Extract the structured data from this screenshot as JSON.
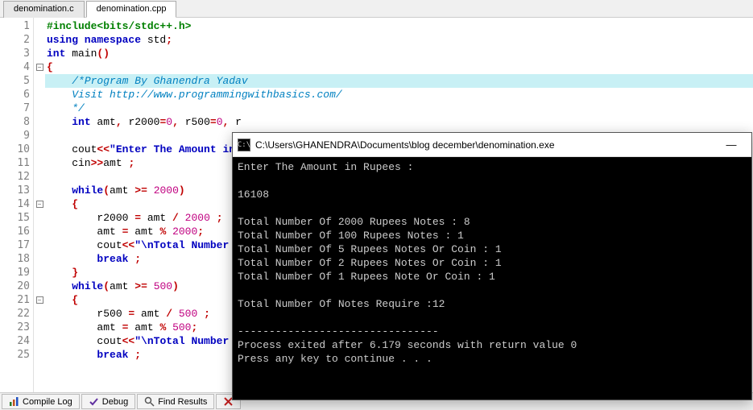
{
  "tabs": {
    "items": [
      "denomination.c",
      "denomination.cpp"
    ],
    "active_index": 1
  },
  "code": {
    "lines": [
      {
        "n": 1,
        "fold": "",
        "hl": false,
        "tokens": [
          [
            "pp",
            "#include<bits/stdc++.h>"
          ]
        ]
      },
      {
        "n": 2,
        "fold": "",
        "hl": false,
        "tokens": [
          [
            "kw",
            "using namespace"
          ],
          [
            "plain",
            " std"
          ],
          [
            "op",
            ";"
          ]
        ]
      },
      {
        "n": 3,
        "fold": "",
        "hl": false,
        "tokens": [
          [
            "kw",
            "int"
          ],
          [
            "plain",
            " main"
          ],
          [
            "br",
            "()"
          ]
        ]
      },
      {
        "n": 4,
        "fold": "-",
        "hl": false,
        "tokens": [
          [
            "br",
            "{"
          ]
        ]
      },
      {
        "n": 5,
        "fold": "",
        "hl": true,
        "tokens": [
          [
            "plain",
            "    "
          ],
          [
            "cmt",
            "/*Program By Ghanendra Yadav"
          ]
        ]
      },
      {
        "n": 6,
        "fold": "",
        "hl": false,
        "tokens": [
          [
            "plain",
            "    "
          ],
          [
            "cmt",
            "Visit http://www.programmingwithbasics.com/"
          ]
        ]
      },
      {
        "n": 7,
        "fold": "",
        "hl": false,
        "tokens": [
          [
            "plain",
            "    "
          ],
          [
            "cmt",
            "*/"
          ]
        ]
      },
      {
        "n": 8,
        "fold": "",
        "hl": false,
        "tokens": [
          [
            "plain",
            "    "
          ],
          [
            "kw",
            "int"
          ],
          [
            "plain",
            " amt"
          ],
          [
            "op",
            ","
          ],
          [
            "plain",
            " r2000"
          ],
          [
            "op",
            "="
          ],
          [
            "num",
            "0"
          ],
          [
            "op",
            ","
          ],
          [
            "plain",
            " r500"
          ],
          [
            "op",
            "="
          ],
          [
            "num",
            "0"
          ],
          [
            "op",
            ","
          ],
          [
            "plain",
            " r"
          ]
        ]
      },
      {
        "n": 9,
        "fold": "",
        "hl": false,
        "tokens": []
      },
      {
        "n": 10,
        "fold": "",
        "hl": false,
        "tokens": [
          [
            "plain",
            "    cout"
          ],
          [
            "op",
            "<<"
          ],
          [
            "str",
            "\"Enter The Amount in "
          ]
        ]
      },
      {
        "n": 11,
        "fold": "",
        "hl": false,
        "tokens": [
          [
            "plain",
            "    cin"
          ],
          [
            "op",
            ">>"
          ],
          [
            "plain",
            "amt "
          ],
          [
            "op",
            ";"
          ]
        ]
      },
      {
        "n": 12,
        "fold": "",
        "hl": false,
        "tokens": []
      },
      {
        "n": 13,
        "fold": "",
        "hl": false,
        "tokens": [
          [
            "plain",
            "    "
          ],
          [
            "kw",
            "while"
          ],
          [
            "br",
            "("
          ],
          [
            "plain",
            "amt "
          ],
          [
            "op",
            ">="
          ],
          [
            "plain",
            " "
          ],
          [
            "num",
            "2000"
          ],
          [
            "br",
            ")"
          ]
        ]
      },
      {
        "n": 14,
        "fold": "-",
        "hl": false,
        "tokens": [
          [
            "plain",
            "    "
          ],
          [
            "br",
            "{"
          ]
        ]
      },
      {
        "n": 15,
        "fold": "",
        "hl": false,
        "tokens": [
          [
            "plain",
            "        r2000 "
          ],
          [
            "op",
            "="
          ],
          [
            "plain",
            " amt "
          ],
          [
            "op",
            "/"
          ],
          [
            "plain",
            " "
          ],
          [
            "num",
            "2000"
          ],
          [
            "plain",
            " "
          ],
          [
            "op",
            ";"
          ]
        ]
      },
      {
        "n": 16,
        "fold": "",
        "hl": false,
        "tokens": [
          [
            "plain",
            "        amt "
          ],
          [
            "op",
            "="
          ],
          [
            "plain",
            " amt "
          ],
          [
            "op",
            "%"
          ],
          [
            "plain",
            " "
          ],
          [
            "num",
            "2000"
          ],
          [
            "op",
            ";"
          ]
        ]
      },
      {
        "n": 17,
        "fold": "",
        "hl": false,
        "tokens": [
          [
            "plain",
            "        cout"
          ],
          [
            "op",
            "<<"
          ],
          [
            "str",
            "\"\\nTotal Number O"
          ]
        ]
      },
      {
        "n": 18,
        "fold": "",
        "hl": false,
        "tokens": [
          [
            "plain",
            "        "
          ],
          [
            "kw",
            "break"
          ],
          [
            "plain",
            " "
          ],
          [
            "op",
            ";"
          ]
        ]
      },
      {
        "n": 19,
        "fold": "",
        "hl": false,
        "tokens": [
          [
            "plain",
            "    "
          ],
          [
            "br",
            "}"
          ]
        ]
      },
      {
        "n": 20,
        "fold": "",
        "hl": false,
        "tokens": [
          [
            "plain",
            "    "
          ],
          [
            "kw",
            "while"
          ],
          [
            "br",
            "("
          ],
          [
            "plain",
            "amt "
          ],
          [
            "op",
            ">="
          ],
          [
            "plain",
            " "
          ],
          [
            "num",
            "500"
          ],
          [
            "br",
            ")"
          ]
        ]
      },
      {
        "n": 21,
        "fold": "-",
        "hl": false,
        "tokens": [
          [
            "plain",
            "    "
          ],
          [
            "br",
            "{"
          ]
        ]
      },
      {
        "n": 22,
        "fold": "",
        "hl": false,
        "tokens": [
          [
            "plain",
            "        r500 "
          ],
          [
            "op",
            "="
          ],
          [
            "plain",
            " amt "
          ],
          [
            "op",
            "/"
          ],
          [
            "plain",
            " "
          ],
          [
            "num",
            "500"
          ],
          [
            "plain",
            " "
          ],
          [
            "op",
            ";"
          ]
        ]
      },
      {
        "n": 23,
        "fold": "",
        "hl": false,
        "tokens": [
          [
            "plain",
            "        amt "
          ],
          [
            "op",
            "="
          ],
          [
            "plain",
            " amt "
          ],
          [
            "op",
            "%"
          ],
          [
            "plain",
            " "
          ],
          [
            "num",
            "500"
          ],
          [
            "op",
            ";"
          ]
        ]
      },
      {
        "n": 24,
        "fold": "",
        "hl": false,
        "tokens": [
          [
            "plain",
            "        cout"
          ],
          [
            "op",
            "<<"
          ],
          [
            "str",
            "\"\\nTotal Number O"
          ]
        ]
      },
      {
        "n": 25,
        "fold": "",
        "hl": false,
        "tokens": [
          [
            "plain",
            "        "
          ],
          [
            "kw",
            "break"
          ],
          [
            "plain",
            " "
          ],
          [
            "op",
            ";"
          ]
        ]
      }
    ]
  },
  "console": {
    "title": "C:\\Users\\GHANENDRA\\Documents\\blog december\\denomination.exe",
    "icon_glyph": "C:\\",
    "minimize": "—",
    "lines": [
      "Enter The Amount in Rupees :",
      "",
      "16108",
      "",
      "Total Number Of 2000 Rupees Notes : 8",
      "Total Number Of 100 Rupees Notes : 1",
      "Total Number Of 5 Rupees Notes Or Coin : 1",
      "Total Number Of 2 Rupees Notes Or Coin : 1",
      "Total Number Of 1 Rupees Note Or Coin : 1",
      "",
      "Total Number Of Notes Require :12",
      "",
      "--------------------------------",
      "Process exited after 6.179 seconds with return value 0",
      "Press any key to continue . . ."
    ]
  },
  "bottom_tabs": [
    {
      "label": "Compile Log",
      "icon": "bar-chart-icon"
    },
    {
      "label": "Debug",
      "icon": "check-icon"
    },
    {
      "label": "Find Results",
      "icon": "search-icon"
    },
    {
      "label": "",
      "icon": "close-icon"
    }
  ]
}
